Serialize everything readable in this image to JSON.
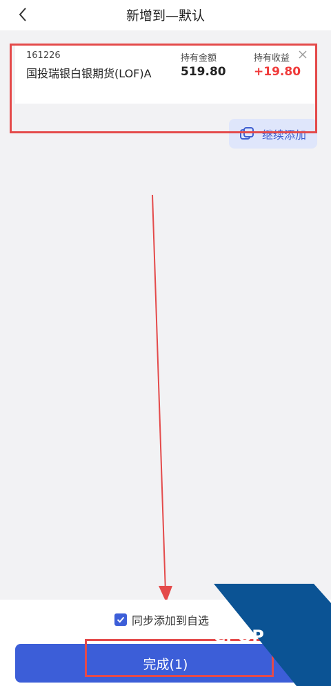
{
  "header": {
    "title": "新增到—默认"
  },
  "holding_card": {
    "code": "161226",
    "name": "国投瑞银白银期货(LOF)A",
    "amount_label": "持有金额",
    "amount_value": "519.80",
    "profit_label": "持有收益",
    "profit_value": "+19.80"
  },
  "continue_add": {
    "label": "继续添加"
  },
  "footer": {
    "sync_label": "同步添加到自选",
    "sync_checked": true,
    "done_label": "完成(1)"
  },
  "watermark": {
    "text": "PCPOP下载"
  },
  "colors": {
    "accent": "#3c5ed8",
    "profit": "#f03a3a",
    "highlight": "#e44a4a"
  }
}
